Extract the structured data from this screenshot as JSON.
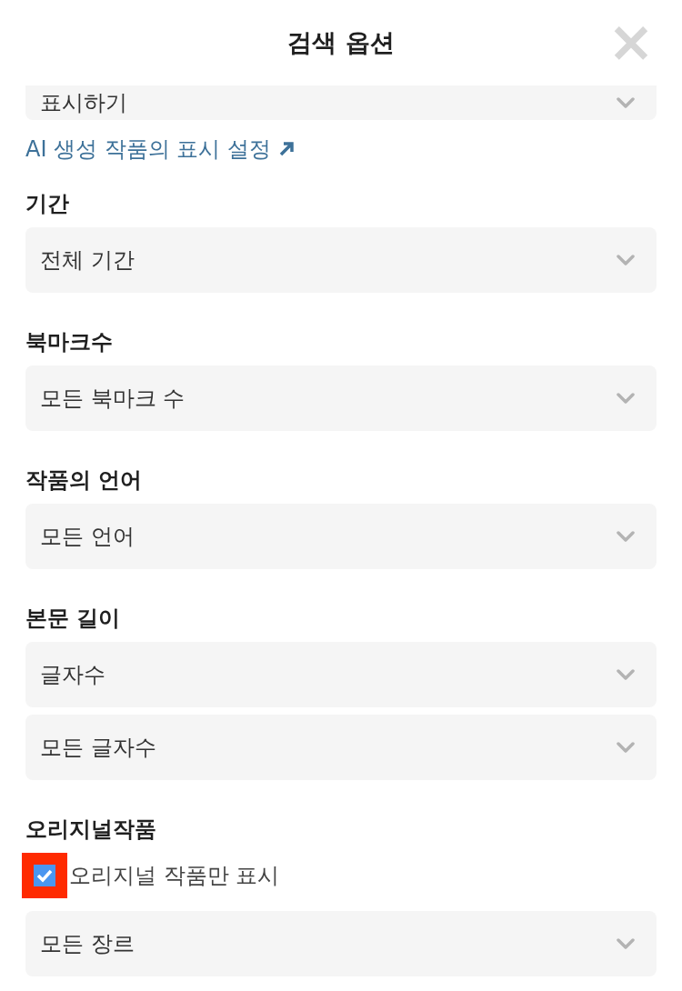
{
  "header": {
    "title": "검색 옵션",
    "close": "×"
  },
  "top_dropdown": {
    "value": "표시하기"
  },
  "ai_link": {
    "label": "AI 생성 작품의 표시 설정"
  },
  "sections": [
    {
      "label": "기간",
      "items": [
        {
          "kind": "dropdown",
          "value": "전체 기간"
        }
      ]
    },
    {
      "label": "북마크수",
      "items": [
        {
          "kind": "dropdown",
          "value": "모든 북마크 수"
        }
      ]
    },
    {
      "label": "작품의 언어",
      "items": [
        {
          "kind": "dropdown",
          "value": "모든 언어"
        }
      ]
    },
    {
      "label": "본문 길이",
      "items": [
        {
          "kind": "dropdown",
          "value": "글자수"
        },
        {
          "kind": "dropdown",
          "value": "모든 글자수"
        }
      ]
    },
    {
      "label": "오리지널작품",
      "items": [
        {
          "kind": "checkbox",
          "label": "오리지널 작품만 표시",
          "checked": true
        },
        {
          "kind": "dropdown",
          "value": "모든 장르"
        }
      ]
    }
  ]
}
